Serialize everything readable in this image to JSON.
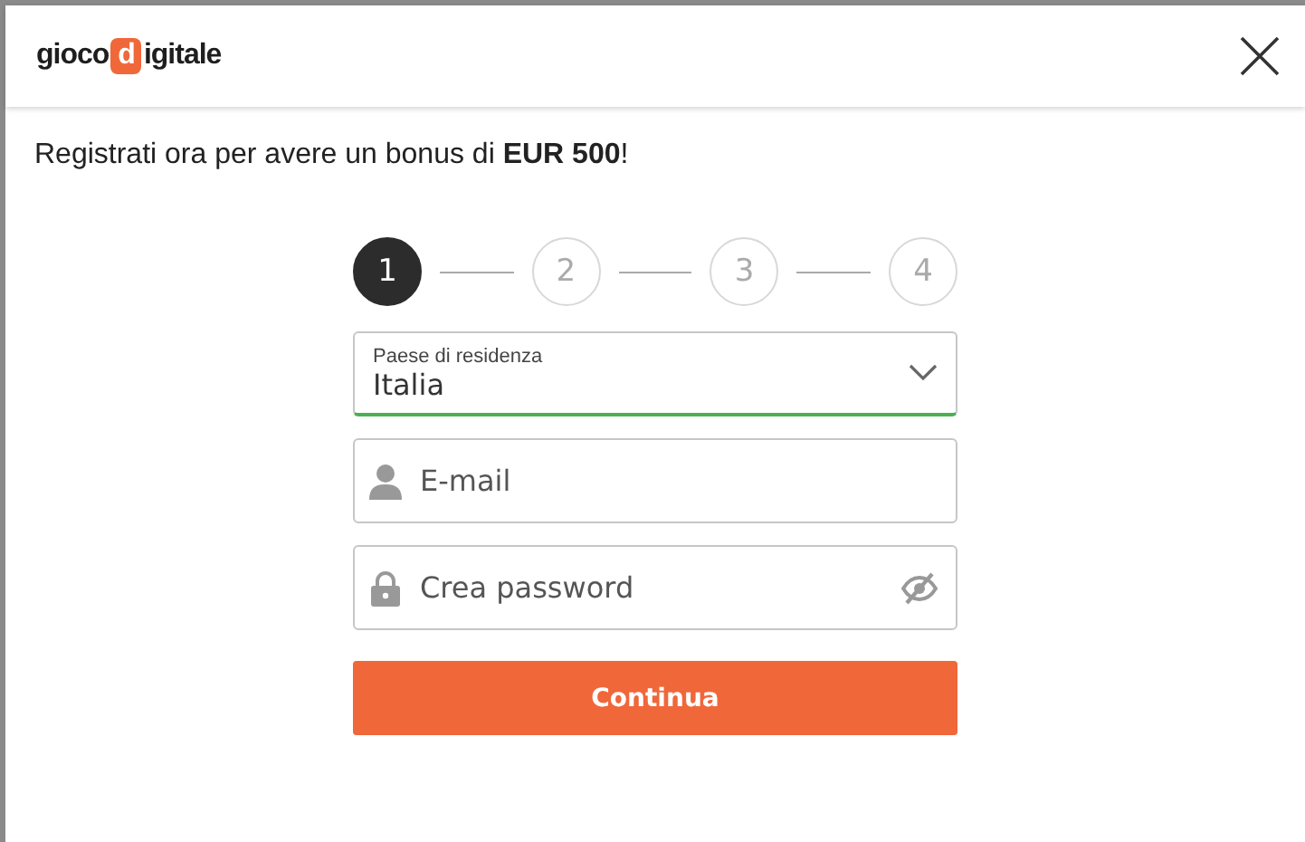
{
  "header": {
    "logo": {
      "before": "gioco",
      "mark": "d",
      "after": "igitale"
    }
  },
  "intro": "Registrati ora per avere un bonus di **EUR 500**!",
  "steps": [
    {
      "label": "1",
      "selected": true
    },
    {
      "label": "2",
      "selected": false
    },
    {
      "label": "3",
      "selected": false
    },
    {
      "label": "4",
      "selected": false
    }
  ],
  "fields": [
    {
      "kind": "select",
      "label": "Paese di residenza",
      "value": "Italia",
      "valid": true
    },
    {
      "kind": "email",
      "placeholder": "E-mail"
    },
    {
      "kind": "password",
      "placeholder": "Crea password"
    }
  ],
  "submit": "Continua"
}
